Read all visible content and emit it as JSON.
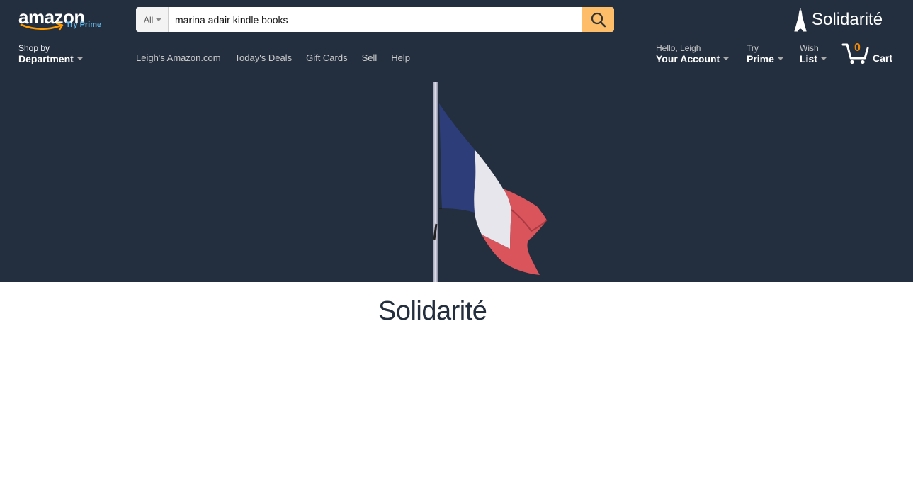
{
  "logo": {
    "wordmark": "amazon",
    "try_prime": "Try Prime"
  },
  "search": {
    "category": "All",
    "query": "marina adair kindle books"
  },
  "campaign_logo": "Solidarité",
  "shop_by": {
    "line1": "Shop by",
    "line2": "Department"
  },
  "nav_links": [
    "Leigh's Amazon.com",
    "Today's Deals",
    "Gift Cards",
    "Sell",
    "Help"
  ],
  "account": {
    "line1": "Hello, Leigh",
    "line2": "Your Account"
  },
  "prime": {
    "line1": "Try",
    "line2": "Prime"
  },
  "wishlist": {
    "line1": "Wish",
    "line2": "List"
  },
  "cart": {
    "count": "0",
    "label": "Cart"
  },
  "page_title": "Solidarité",
  "colors": {
    "header_bg": "#232f3e",
    "search_button": "#febd69",
    "cart_count": "#f08804",
    "flag_blue": "#2d3d7a",
    "flag_white": "#e8e8ee",
    "flag_red": "#d9545b"
  }
}
